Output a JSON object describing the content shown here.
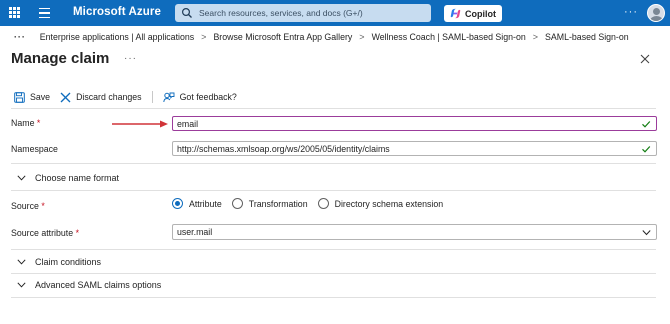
{
  "topbar": {
    "brand": "Microsoft Azure",
    "search_placeholder": "Search resources, services, and docs (G+/)",
    "copilot_label": "Copilot",
    "more": "···",
    "accent_color": "#0f6cbd"
  },
  "breadcrumb": {
    "ellipsis": "···",
    "items": [
      "Enterprise applications | All applications",
      "Browse Microsoft Entra App Gallery",
      "Wellness Coach | SAML-based Sign-on",
      "SAML-based Sign-on"
    ],
    "separator": ">"
  },
  "page": {
    "title": "Manage claim",
    "more": "···"
  },
  "toolbar": {
    "save_label": "Save",
    "discard_label": "Discard changes",
    "feedback_label": "Got feedback?"
  },
  "form": {
    "name_label": "Name",
    "required_marker": "*",
    "name_value": "email",
    "namespace_label": "Namespace",
    "namespace_value": "http://schemas.xmlsoap.org/ws/2005/05/identity/claims",
    "choose_name_format": "Choose name format",
    "source_label": "Source",
    "source_options": [
      "Attribute",
      "Transformation",
      "Directory schema extension"
    ],
    "source_selected": "Attribute",
    "source_attribute_label": "Source attribute",
    "source_attribute_value": "user.mail",
    "claim_conditions": "Claim conditions",
    "advanced_options": "Advanced SAML claims options"
  },
  "colors": {
    "required": "#c50f1f",
    "valid_check": "#107c10",
    "annotation_arrow": "#d13438",
    "focus_border": "#9b3c9b"
  }
}
